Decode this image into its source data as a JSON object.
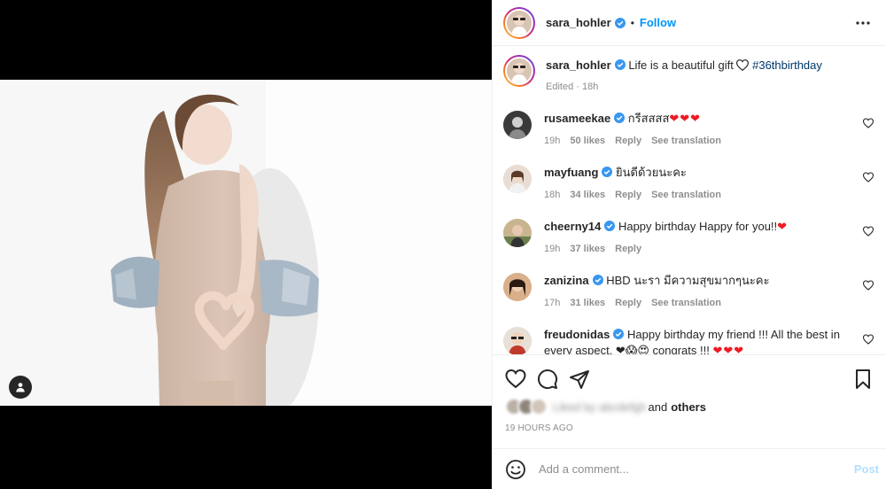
{
  "post": {
    "author": "sara_hohler",
    "follow_label": "Follow",
    "dot": "•",
    "caption": {
      "text": "Life is a beautiful gift",
      "hashtag": "#36thbirthday",
      "meta": "Edited · 18h"
    }
  },
  "comments": [
    {
      "user": "rusameekae",
      "text": "กรีสสสส",
      "emoji": "❤❤❤",
      "time": "19h",
      "likes": "50 likes",
      "reply": "Reply",
      "translate": "See translation"
    },
    {
      "user": "mayfuang",
      "text": "ยินดีด้วยนะคะ",
      "emoji": "",
      "time": "18h",
      "likes": "34 likes",
      "reply": "Reply",
      "translate": "See translation"
    },
    {
      "user": "cheerny14",
      "text": "Happy birthday Happy for you!!",
      "emoji": "❤",
      "time": "19h",
      "likes": "37 likes",
      "reply": "Reply",
      "translate": ""
    },
    {
      "user": "zanizina",
      "text": "HBD นะรา มีความสุขมากๆนะคะ",
      "emoji": "",
      "time": "17h",
      "likes": "31 likes",
      "reply": "Reply",
      "translate": "See translation"
    },
    {
      "user": "freudonidas",
      "text": "Happy birthday my friend !!! All the best in every aspect. ❤😱😍 congrats !!! ",
      "emoji": "❤❤❤",
      "time": "",
      "likes": "",
      "reply": "",
      "translate": ""
    }
  ],
  "likes_line": {
    "blurred": "Liked by abcdefgh",
    "suffix": "and",
    "others": "others"
  },
  "timestamp": "19 HOURS AGO",
  "add_comment": {
    "placeholder": "Add a comment...",
    "post_label": "Post"
  },
  "icons": [
    "verified-badge-icon",
    "more-options-icon",
    "heart-icon",
    "comment-icon",
    "share-icon",
    "bookmark-icon",
    "emoji-icon",
    "user-tag-icon"
  ],
  "colors": {
    "accent": "#0095f6",
    "verified": "#3897f0",
    "heart_red": "#ed1c24",
    "post_disabled": "#b2dffc"
  }
}
